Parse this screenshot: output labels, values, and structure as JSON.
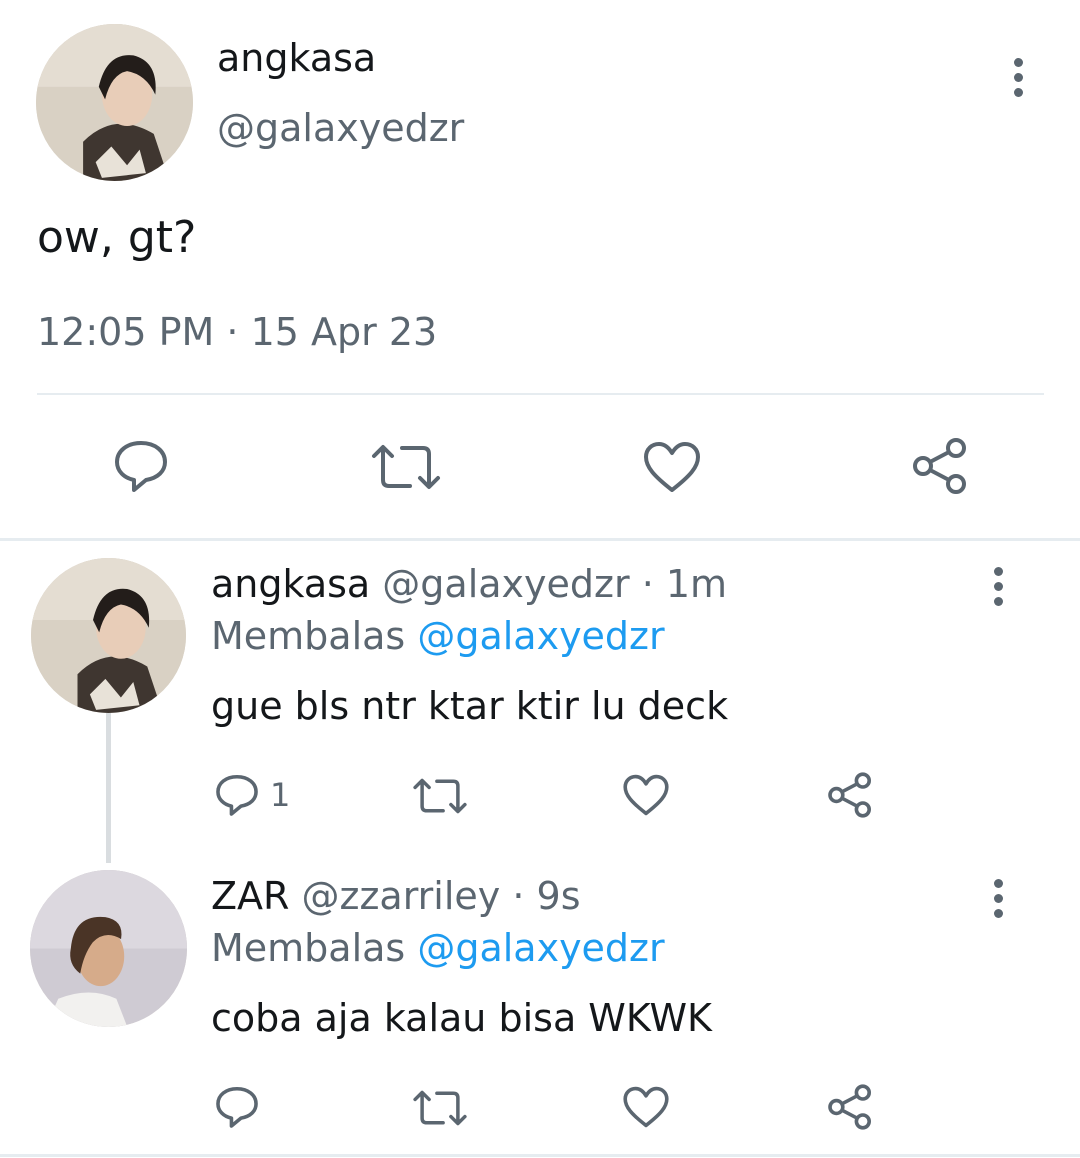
{
  "main_tweet": {
    "author_name": "angkasa",
    "author_handle": "@galaxyedzr",
    "text": "ow, gt?",
    "time": "12:05 PM",
    "separator": "·",
    "date": "15 Apr 23"
  },
  "replies": [
    {
      "name": "angkasa",
      "handle": "@galaxyedzr",
      "age": "· 1m",
      "replying_prefix": "Membalas",
      "replying_to": "@galaxyedzr",
      "text": "gue bls ntr ktar ktir lu deck",
      "reply_count": "1"
    },
    {
      "name": "ZAR",
      "handle": "@zzarriley",
      "age": "· 9s",
      "replying_prefix": "Membalas",
      "replying_to": "@galaxyedzr",
      "text": "coba aja kalau bisa WKWK",
      "reply_count": ""
    }
  ],
  "icons": {
    "reply": "speech-bubble-icon",
    "retweet": "retweet-icon",
    "like": "heart-icon",
    "share": "share-icon",
    "more": "more-vertical-icon"
  },
  "colors": {
    "text": "#14171a",
    "secondary": "#5b6670",
    "link": "#1d9bf0",
    "divider": "#e6ecf0"
  }
}
